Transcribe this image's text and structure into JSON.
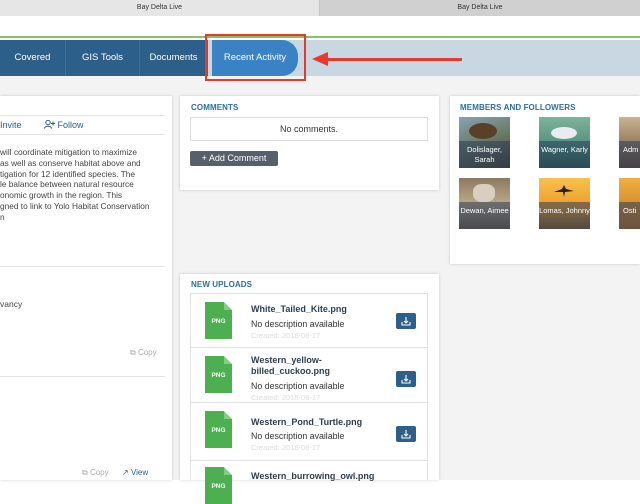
{
  "browser": {
    "tabs": [
      {
        "title": "Bay Delta Live"
      },
      {
        "title": "Bay Delta Live"
      }
    ]
  },
  "nav": {
    "items": [
      {
        "label": "Covered Species"
      },
      {
        "label": "GIS Tools"
      },
      {
        "label": "Documents"
      },
      {
        "label": "Recent Activity",
        "active": true
      }
    ]
  },
  "left": {
    "invite_label": "Invite",
    "follow_label": "Follow",
    "description_lines": [
      "will coordinate mitigation to maximize",
      "as well as conserve habitat above and",
      "tigation for 12 identified species. The",
      "le balance between natural resource",
      "onomic growth in the region. This",
      "gned to link to Yolo Habitat Conservation",
      "n"
    ],
    "org_fragment": "vancy",
    "copy_label": "Copy",
    "view_label": "View"
  },
  "comments": {
    "title": "COMMENTS",
    "empty_text": "No comments.",
    "add_button": "Add Comment"
  },
  "members": {
    "title": "MEMBERS AND FOLLOWERS",
    "people": [
      {
        "name": "Dolislager, Sarah"
      },
      {
        "name": "Wagner, Karly"
      },
      {
        "name": "Adm"
      },
      {
        "name": "Dewan, Aimee"
      },
      {
        "name": "Lomas, Johnny"
      },
      {
        "name": "Osti"
      }
    ]
  },
  "uploads": {
    "title": "NEW UPLOADS",
    "files": [
      {
        "name_lines": [
          "White_Tailed_Kite.png"
        ],
        "description": "No description available",
        "created": "Created: 2018-08-17",
        "type": "PNG"
      },
      {
        "name_lines": [
          "Western_yellow-",
          "billed_cuckoo.png"
        ],
        "description": "No description available",
        "created": "Created: 2018-08-17",
        "type": "PNG"
      },
      {
        "name_lines": [
          "Western_Pond_Turtle.png"
        ],
        "description": "No description available",
        "created": "Created: 2018-08-17",
        "type": "PNG"
      },
      {
        "name_lines": [
          "Western_burrowing_owl.png"
        ],
        "description": "",
        "created": "",
        "type": "PNG"
      }
    ]
  },
  "colors": {
    "nav_bg": "#2c5f8a",
    "nav_active": "#3a82c4",
    "annotation_red": "#e33b2f",
    "accent_green": "#4caf50",
    "section_title": "#2c6e9b"
  }
}
